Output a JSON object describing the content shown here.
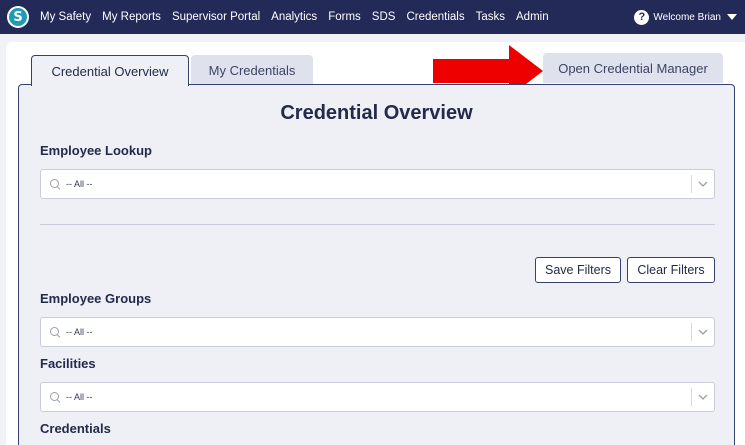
{
  "nav": {
    "logo_letter": "S",
    "items": [
      "My Safety",
      "My Reports",
      "Supervisor Portal",
      "Analytics",
      "Forms",
      "SDS",
      "Credentials",
      "Tasks",
      "Admin"
    ],
    "help_glyph": "?",
    "welcome": "Welcome Brian"
  },
  "tabs": {
    "overview": "Credential Overview",
    "my_credentials": "My Credentials",
    "manager": "Open Credential Manager"
  },
  "main": {
    "heading": "Credential Overview",
    "employee_lookup": {
      "label": "Employee Lookup",
      "value": "-- All --"
    },
    "save_filters": "Save Filters",
    "clear_filters": "Clear Filters",
    "employee_groups": {
      "label": "Employee Groups",
      "value": "-- All --"
    },
    "facilities": {
      "label": "Facilities",
      "value": "-- All --"
    },
    "credentials": {
      "label": "Credentials"
    }
  },
  "colors": {
    "nav_bg": "#232a58",
    "arrow": "#ee0000",
    "panel_bg": "#eef0f6",
    "accent_border": "#36406e"
  }
}
